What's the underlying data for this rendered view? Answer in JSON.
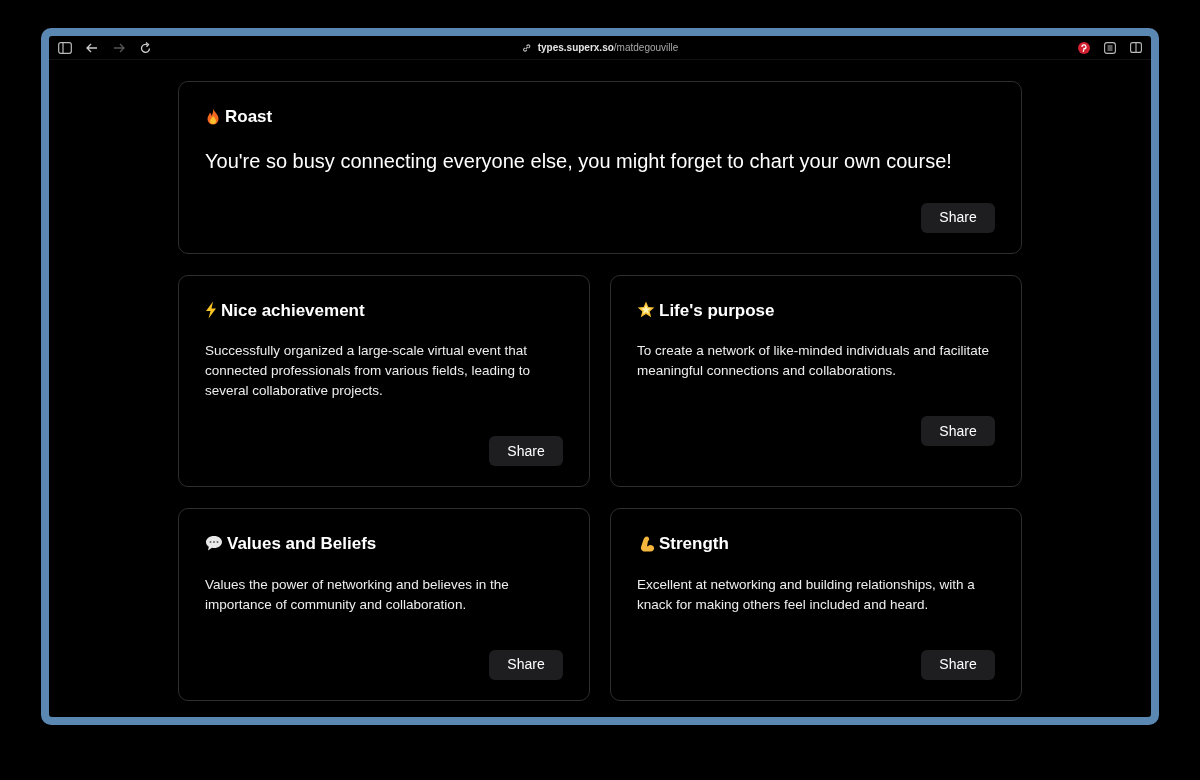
{
  "browser": {
    "url_host": "types.superx.so",
    "url_path": "/matdegouville",
    "forward_disabled": true
  },
  "cards": [
    {
      "title": "Roast",
      "text": "You're so busy connecting everyone else, you might forget to chart your own course!",
      "button": "Share"
    },
    {
      "title": "Nice achievement",
      "text": "Successfully organized a large-scale virtual event that connected professionals from various fields, leading to several collaborative projects.",
      "button": "Share"
    },
    {
      "title": "Life's purpose",
      "text": "To create a network of like-minded individuals and facilitate meaningful connections and collaborations.",
      "button": "Share"
    },
    {
      "title": "Values and Beliefs",
      "text": "Values the power of networking and believes in the importance of community and collaboration.",
      "button": "Share"
    },
    {
      "title": "Strength",
      "text": "Excellent at networking and building relationships, with a knack for making others feel included and heard.",
      "button": "Share"
    }
  ]
}
